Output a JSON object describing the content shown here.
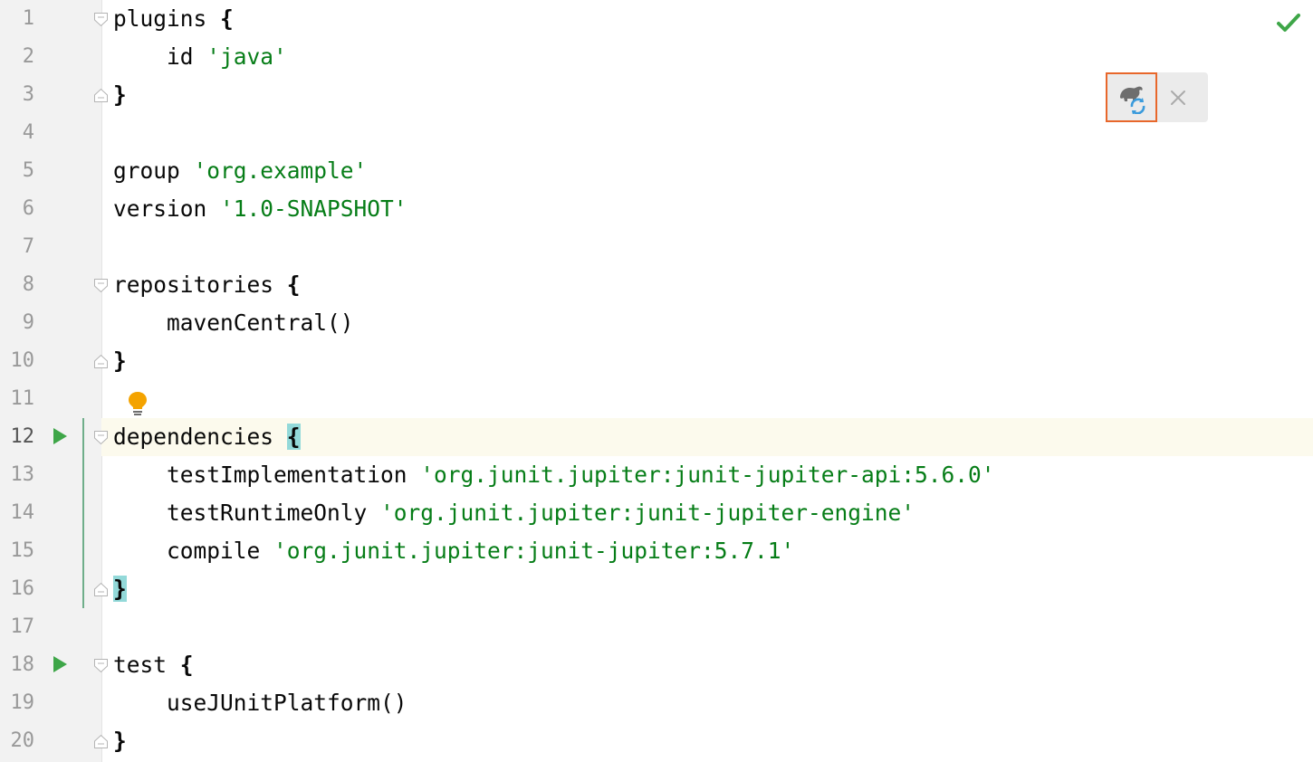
{
  "editor": {
    "status": "no-problems",
    "check_icon": "checkmark-icon",
    "current_line": 12,
    "lines": [
      {
        "num": "1",
        "tokens": [
          {
            "t": "plugins ",
            "c": "plain"
          },
          {
            "t": "{",
            "c": "brace"
          }
        ],
        "fold": "start"
      },
      {
        "num": "2",
        "tokens": [
          {
            "t": "    id ",
            "c": "plain"
          },
          {
            "t": "'java'",
            "c": "str"
          }
        ]
      },
      {
        "num": "3",
        "tokens": [
          {
            "t": "}",
            "c": "brace"
          }
        ],
        "fold": "end"
      },
      {
        "num": "4",
        "tokens": []
      },
      {
        "num": "5",
        "tokens": [
          {
            "t": "group ",
            "c": "plain"
          },
          {
            "t": "'org.example'",
            "c": "str"
          }
        ]
      },
      {
        "num": "6",
        "tokens": [
          {
            "t": "version ",
            "c": "plain"
          },
          {
            "t": "'1.0-SNAPSHOT'",
            "c": "str"
          }
        ]
      },
      {
        "num": "7",
        "tokens": []
      },
      {
        "num": "8",
        "tokens": [
          {
            "t": "repositories ",
            "c": "plain"
          },
          {
            "t": "{",
            "c": "brace"
          }
        ],
        "fold": "start"
      },
      {
        "num": "9",
        "tokens": [
          {
            "t": "    mavenCentral()",
            "c": "plain"
          }
        ]
      },
      {
        "num": "10",
        "tokens": [
          {
            "t": "}",
            "c": "brace"
          }
        ],
        "fold": "end"
      },
      {
        "num": "11",
        "tokens": []
      },
      {
        "num": "12",
        "tokens": [
          {
            "t": "dependencies ",
            "c": "plain"
          },
          {
            "t": "{",
            "c": "brace match"
          }
        ],
        "fold": "start",
        "run": true
      },
      {
        "num": "13",
        "tokens": [
          {
            "t": "    testImplementation ",
            "c": "plain"
          },
          {
            "t": "'org.junit.jupiter:junit-jupiter-api:5.6.0'",
            "c": "str"
          }
        ]
      },
      {
        "num": "14",
        "tokens": [
          {
            "t": "    testRuntimeOnly ",
            "c": "plain"
          },
          {
            "t": "'org.junit.jupiter:junit-jupiter-engine'",
            "c": "str"
          }
        ]
      },
      {
        "num": "15",
        "tokens": [
          {
            "t": "    compile ",
            "c": "plain"
          },
          {
            "t": "'org.junit.jupiter:junit-jupiter:5.7.1'",
            "c": "str"
          }
        ]
      },
      {
        "num": "16",
        "tokens": [
          {
            "t": "}",
            "c": "brace match"
          }
        ],
        "fold": "end"
      },
      {
        "num": "17",
        "tokens": []
      },
      {
        "num": "18",
        "tokens": [
          {
            "t": "test ",
            "c": "plain"
          },
          {
            "t": "{",
            "c": "brace"
          }
        ],
        "fold": "start",
        "run": true
      },
      {
        "num": "19",
        "tokens": [
          {
            "t": "    useJUnitPlatform()",
            "c": "plain"
          }
        ]
      },
      {
        "num": "20",
        "tokens": [
          {
            "t": "}",
            "c": "brace"
          }
        ],
        "fold": "end"
      }
    ]
  },
  "floating_toolbar": {
    "reload_icon": "gradle-reload-icon",
    "close_icon": "close-icon"
  },
  "intention": {
    "icon": "lightbulb-icon",
    "line": 11
  },
  "colors": {
    "string": "#067d17",
    "brace_match": "#93d9d9",
    "current_line": "#fcfaed",
    "run_green": "#3ea648",
    "highlight_border": "#e8672b",
    "check_green": "#3ea648",
    "gradle_blue": "#3a9bdc",
    "bulb": "#f4a300"
  }
}
